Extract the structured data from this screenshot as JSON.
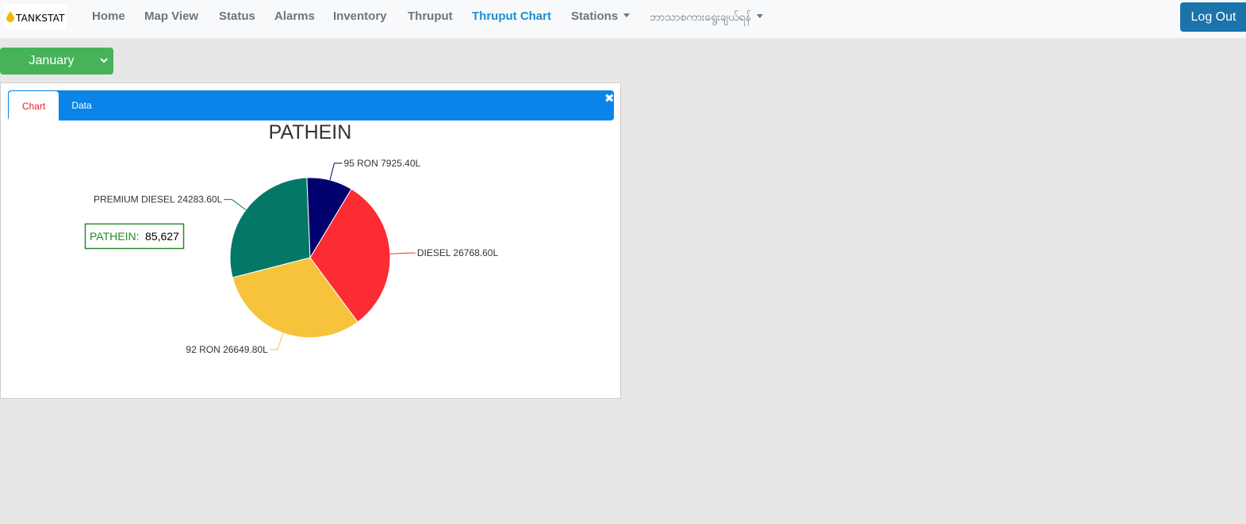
{
  "brand": {
    "text": "TANKSTAT",
    "icon": "fuel-drop-icon",
    "color": "#f5b800"
  },
  "nav": {
    "items": [
      {
        "label": "Home"
      },
      {
        "label": "Map View"
      },
      {
        "label": "Status"
      },
      {
        "label": "Alarms"
      },
      {
        "label": "Inventory"
      },
      {
        "label": "Thruput"
      },
      {
        "label": "Thruput Chart",
        "active": true
      },
      {
        "label": "Stations",
        "dropdown": true
      },
      {
        "label": "ဘာသာစကားရွေးချယ်ရန်",
        "dropdown": true
      }
    ],
    "logout_label": "Log Out"
  },
  "month_select": {
    "value": "January"
  },
  "panel": {
    "tabs": [
      {
        "label": "Chart",
        "active": true
      },
      {
        "label": "Data"
      }
    ],
    "close_icon": "close-icon"
  },
  "chart_data": {
    "type": "pie",
    "title": "PATHEIN",
    "unit": "L",
    "slices": [
      {
        "name": "DIESEL",
        "value": 26768.6,
        "label": "DIESEL 26768.60L",
        "color": "#fb2c32"
      },
      {
        "name": "92 RON",
        "value": 26649.8,
        "label": "92 RON 26649.80L",
        "color": "#f7c33a"
      },
      {
        "name": "PREMIUM DIESEL",
        "value": 24283.6,
        "label": "PREMIUM DIESEL 24283.60L",
        "color": "#037866"
      },
      {
        "name": "95 RON",
        "value": 7925.4,
        "label": "95 RON 7925.40L",
        "color": "#00006e"
      }
    ],
    "tooltip": {
      "name": "PATHEIN:",
      "value": "85,627",
      "color": "#2b8a2b"
    }
  }
}
